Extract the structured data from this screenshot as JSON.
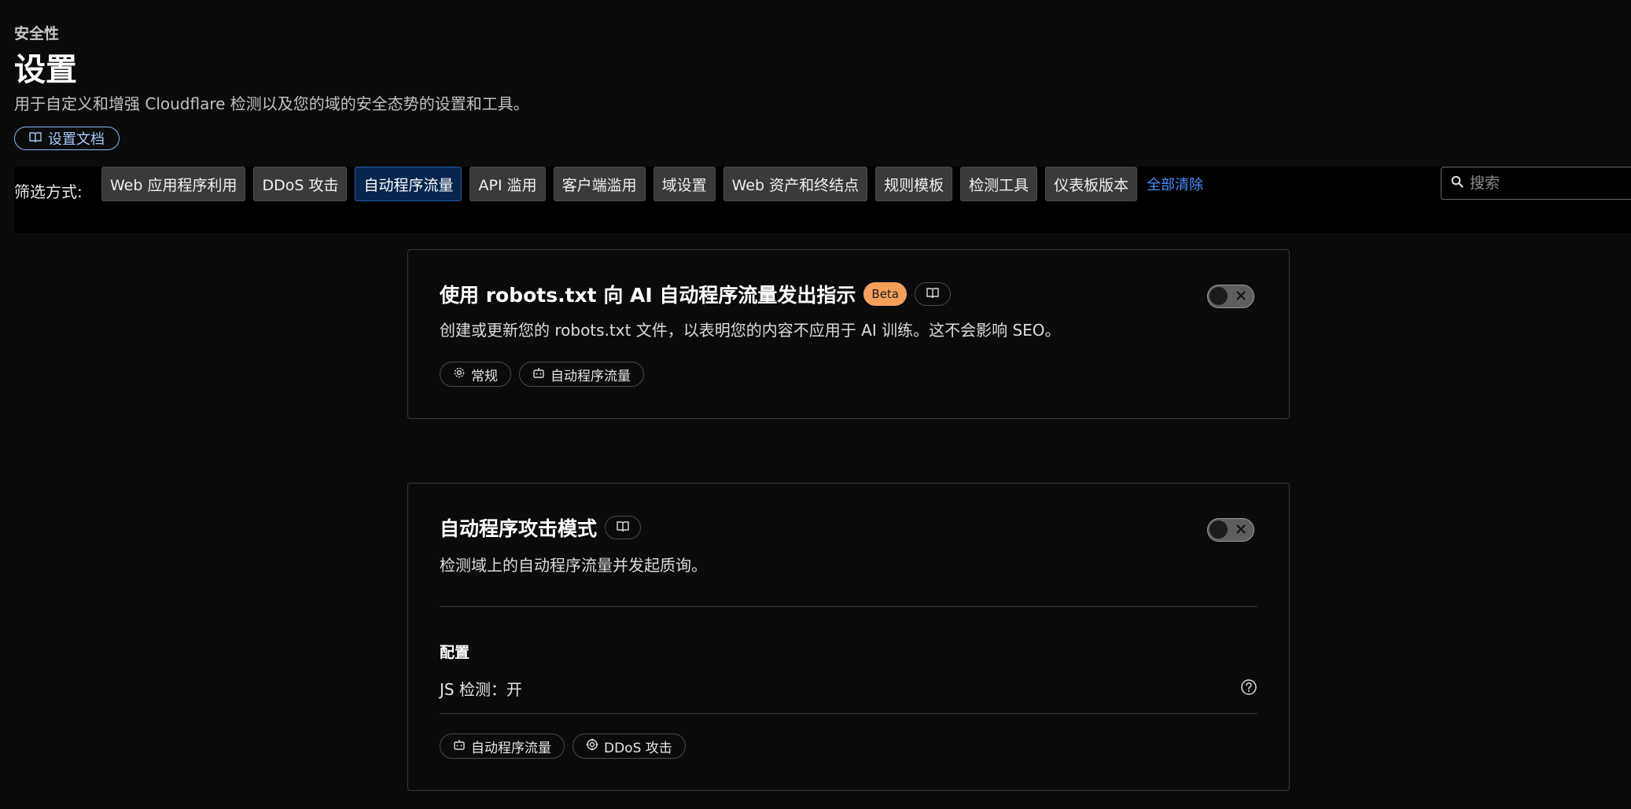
{
  "header": {
    "breadcrumb": "安全性",
    "title": "设置",
    "description": "用于自定义和增强 Cloudflare 检测以及您的域的安全态势的设置和工具。",
    "docs_button": "设置文档"
  },
  "filters": {
    "label": "筛选方式:",
    "chips": [
      {
        "label": "Web 应用程序利用",
        "active": false
      },
      {
        "label": "DDoS 攻击",
        "active": false
      },
      {
        "label": "自动程序流量",
        "active": true
      },
      {
        "label": "API 滥用",
        "active": false
      },
      {
        "label": "客户端滥用",
        "active": false
      },
      {
        "label": "域设置",
        "active": false
      },
      {
        "label": "Web 资产和终结点",
        "active": false
      },
      {
        "label": "规则模板",
        "active": false
      },
      {
        "label": "检测工具",
        "active": false
      },
      {
        "label": "仪表板版本",
        "active": false
      }
    ],
    "clear_all": "全部清除",
    "search_placeholder": "搜索"
  },
  "cards": [
    {
      "title": "使用 robots.txt 向 AI 自动程序流量发出指示",
      "badge": "Beta",
      "description": "创建或更新您的 robots.txt 文件，以表明您的内容不应用于 AI 训练。这不会影响 SEO。",
      "toggle_on": false,
      "tags": [
        {
          "label": "常规",
          "icon": "gear-icon"
        },
        {
          "label": "自动程序流量",
          "icon": "robot-icon"
        }
      ]
    },
    {
      "title": "自动程序攻击模式",
      "description": "检测域上的自动程序流量并发起质询。",
      "toggle_on": false,
      "config_title": "配置",
      "config_item": "JS 检测：开",
      "tags": [
        {
          "label": "自动程序流量",
          "icon": "robot-icon"
        },
        {
          "label": "DDoS 攻击",
          "icon": "target-icon"
        }
      ]
    }
  ],
  "colors": {
    "background": "#0b0b0b",
    "active_chip": "#05264e",
    "accent_link": "#4a90ff",
    "beta_badge": "#f4a05a"
  }
}
